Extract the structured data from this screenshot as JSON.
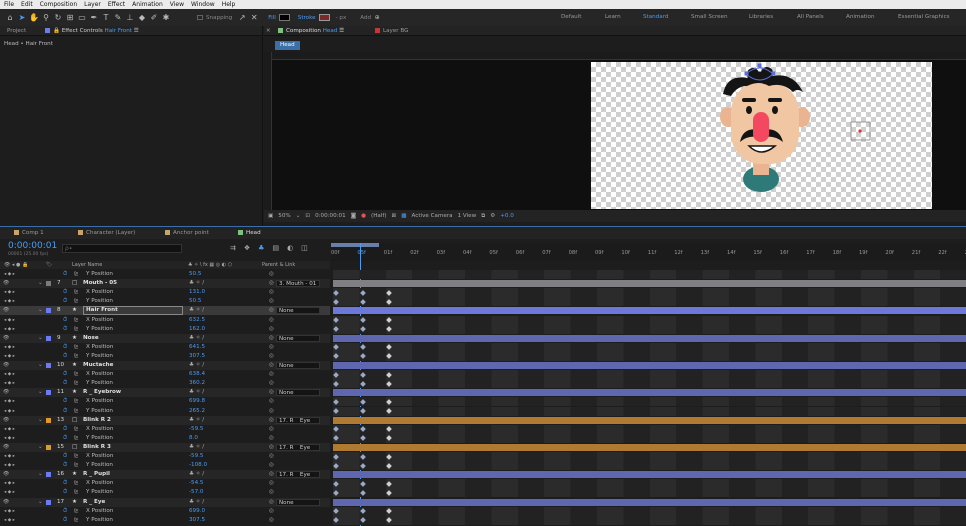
{
  "menu": [
    "File",
    "Edit",
    "Composition",
    "Layer",
    "Effect",
    "Animation",
    "View",
    "Window",
    "Help"
  ],
  "toolbar": {
    "snapping": "Snapping",
    "fill": "Fill",
    "stroke": "Stroke",
    "px": "- px",
    "add": "Add",
    "workspaces": [
      "Default",
      "Learn",
      "Standard",
      "Small Screen",
      "Libraries",
      "All Panels",
      "Animation",
      "Essential Graphics"
    ],
    "active_workspace": "Standard"
  },
  "project_panel": {
    "tab_project": "Project",
    "tab_effect": "Effect Controls",
    "effect_target": "Hair Front",
    "breadcrumb": "Head • Hair Front"
  },
  "comp_panel": {
    "tab_comp": "Composition",
    "comp_name": "Head",
    "tab_layer": "Layer BG",
    "flow_tab": "Head"
  },
  "viewer": {
    "zoom": "50%",
    "time": "0:00:00:01",
    "resolution": "(Half)",
    "camera": "Active Camera",
    "views": "1 View",
    "exposure": "+0.0"
  },
  "timeline": {
    "tabs": [
      "Comp 1",
      "Character (Layer)",
      "Anchor point",
      "Head"
    ],
    "tab_colors": [
      "#c9a46a",
      "#c9a46a",
      "#c9a46a",
      "#7ec07e"
    ],
    "active_tab": "Head",
    "timecode": "0:00:00:01",
    "timecode_sub": "00001 (25.00 fps)",
    "search_placeholder": "ρ∙",
    "col_layer_name": "Layer Name",
    "col_parent": "Parent & Link",
    "ticks": [
      "00f",
      "05f",
      "01f",
      "02f",
      "03f",
      "04f",
      "05f",
      "06f",
      "07f",
      "08f",
      "09f",
      "10f",
      "11f",
      "12f",
      "13f",
      "14f",
      "15f",
      "16f",
      "17f",
      "18f",
      "19f",
      "20f",
      "21f",
      "22f",
      "23f"
    ]
  },
  "rows": [
    {
      "type": "prop",
      "name": "Y Position",
      "value": "50.5",
      "track": "#24a05a"
    },
    {
      "type": "layer",
      "num": "7",
      "label": "#7a7a7a",
      "icon": "□",
      "name": "Mouth - 05",
      "parent": "3. Mouth - 01",
      "track": "#7f7f84"
    },
    {
      "type": "prop",
      "name": "X Position",
      "value": "131.0",
      "track": "#3e3e46"
    },
    {
      "type": "prop",
      "name": "Y Position",
      "value": "50.5",
      "track": "#3e3e46"
    },
    {
      "type": "layer",
      "num": "8",
      "label": "#6b7cf0",
      "icon": "★",
      "name": "Hair Front",
      "parent": "None",
      "track": "#6d79d9",
      "selected": true
    },
    {
      "type": "prop",
      "name": "X Position",
      "value": "632.5",
      "track": "#3e3e46"
    },
    {
      "type": "prop",
      "name": "Y Position",
      "value": "162.0",
      "track": "#3e3e46"
    },
    {
      "type": "layer",
      "num": "9",
      "label": "#6b7cf0",
      "icon": "★",
      "name": "Nose",
      "parent": "None",
      "track": "#5e67b0"
    },
    {
      "type": "prop",
      "name": "X Position",
      "value": "641.5",
      "track": "#3e3e46"
    },
    {
      "type": "prop",
      "name": "Y Position",
      "value": "307.5",
      "track": "#3e3e46"
    },
    {
      "type": "layer",
      "num": "10",
      "label": "#6b7cf0",
      "icon": "★",
      "name": "Muctache",
      "parent": "None",
      "track": "#5e67b0"
    },
    {
      "type": "prop",
      "name": "X Position",
      "value": "638.4",
      "track": "#3e3e46"
    },
    {
      "type": "prop",
      "name": "Y Position",
      "value": "360.2",
      "track": "#3e3e46"
    },
    {
      "type": "layer",
      "num": "11",
      "label": "#6b7cf0",
      "icon": "★",
      "name": "R _ Eyebrow",
      "parent": "None",
      "track": "#5e67b0"
    },
    {
      "type": "prop",
      "name": "X Position",
      "value": "699.8",
      "track": "#3e3e46"
    },
    {
      "type": "prop",
      "name": "Y Position",
      "value": "265.2",
      "track": "#3e3e46"
    },
    {
      "type": "layer",
      "num": "13",
      "label": "#e0972d",
      "icon": "□",
      "name": "Blink R 2",
      "parent": "17. R _ Eye",
      "track": "#b07a32"
    },
    {
      "type": "prop",
      "name": "X Position",
      "value": "-59.5",
      "track": "#3e3e46"
    },
    {
      "type": "prop",
      "name": "Y Position",
      "value": "8.0",
      "track": "#3e3e46"
    },
    {
      "type": "layer",
      "num": "15",
      "label": "#e0972d",
      "icon": "□",
      "name": "Blink R 3",
      "parent": "17. R _ Eye",
      "track": "#b07a32"
    },
    {
      "type": "prop",
      "name": "X Position",
      "value": "-59.5",
      "track": "#3e3e46"
    },
    {
      "type": "prop",
      "name": "Y Position",
      "value": "-108.0",
      "track": "#3e3e46"
    },
    {
      "type": "layer",
      "num": "16",
      "label": "#6b7cf0",
      "icon": "★",
      "name": "R _ Pupil",
      "parent": "17. R _ Eye",
      "track": "#5e67b0"
    },
    {
      "type": "prop",
      "name": "X Position",
      "value": "-54.5",
      "track": "#3e3e46"
    },
    {
      "type": "prop",
      "name": "Y Position",
      "value": "-57.0",
      "track": "#3e3e46"
    },
    {
      "type": "layer",
      "num": "17",
      "label": "#6b7cf0",
      "icon": "★",
      "name": "R _ Eye",
      "parent": "None",
      "track": "#5e67b0"
    },
    {
      "type": "prop",
      "name": "X Position",
      "value": "699.0",
      "track": "#3e3e46"
    },
    {
      "type": "prop",
      "name": "Y Position",
      "value": "307.5",
      "track": "#3e3e46"
    }
  ]
}
